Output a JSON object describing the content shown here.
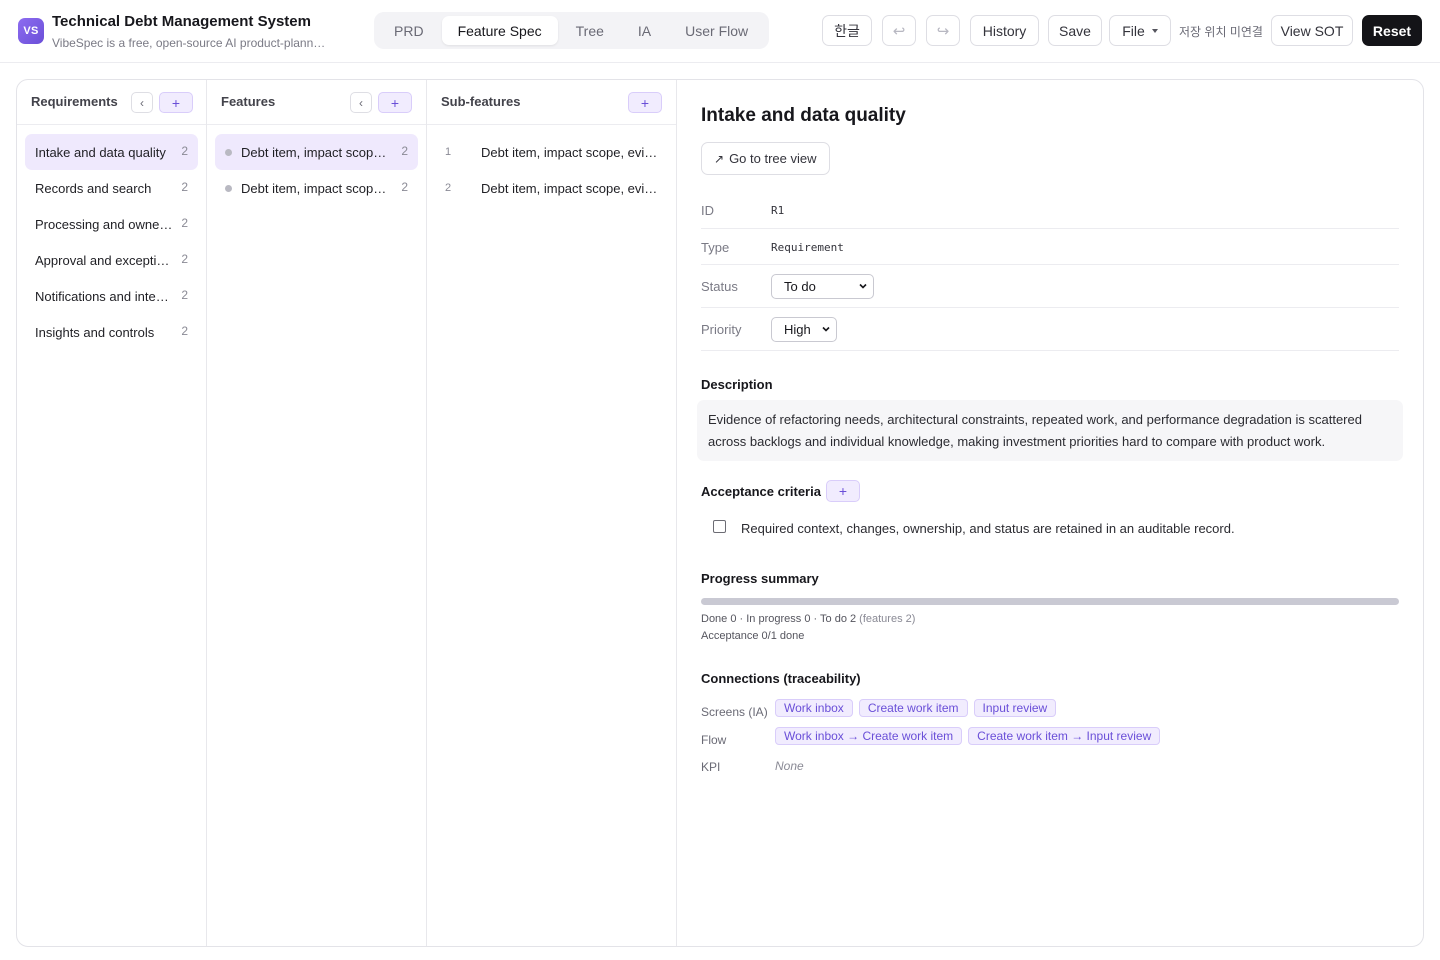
{
  "header": {
    "logo_text": "VS",
    "title": "Technical Debt Management System",
    "subtitle": "VibeSpec is a free, open-source AI product-planning tool",
    "tabs": [
      {
        "label": "PRD",
        "active": false
      },
      {
        "label": "Feature Spec",
        "active": true
      },
      {
        "label": "Tree",
        "active": false
      },
      {
        "label": "IA",
        "active": false
      },
      {
        "label": "User Flow",
        "active": false
      }
    ],
    "lang_label": "한글",
    "undo_icon": "↩",
    "redo_icon": "↪",
    "history_label": "History",
    "save_label": "Save",
    "file_label": "File",
    "save_location": "저장 위치 미연결",
    "view_sot_label": "View SOT",
    "reset_label": "Reset"
  },
  "columns": {
    "requirements": {
      "title": "Requirements",
      "back_icon": "‹",
      "add_icon": "+",
      "items": [
        {
          "label": "Intake and data quality",
          "count": "2"
        },
        {
          "label": "Records and search",
          "count": "2"
        },
        {
          "label": "Processing and ownership",
          "count": "2"
        },
        {
          "label": "Approval and exceptions",
          "count": "2"
        },
        {
          "label": "Notifications and integrations",
          "count": "2"
        },
        {
          "label": "Insights and controls",
          "count": "2"
        }
      ]
    },
    "features": {
      "title": "Features",
      "back_icon": "‹",
      "add_icon": "+",
      "items": [
        {
          "label": "Debt item, impact scope, evidence",
          "count": "2"
        },
        {
          "label": "Debt item, impact scope, evidence",
          "count": "2"
        }
      ]
    },
    "subfeatures": {
      "title": "Sub-features",
      "add_icon": "+",
      "items": [
        {
          "num": "1",
          "label": "Debt item, impact scope, evidence intake"
        },
        {
          "num": "2",
          "label": "Debt item, impact scope, evidence review"
        }
      ]
    }
  },
  "detail": {
    "title": "Intake and data quality",
    "tree_button_icon": "↗",
    "tree_button_label": "Go to tree view",
    "id_label": "ID",
    "id_value": "R1",
    "type_label": "Type",
    "type_value": "Requirement",
    "status_label": "Status",
    "status_value": "To do",
    "priority_label": "Priority",
    "priority_value": "High",
    "description_title": "Description",
    "description": "Evidence of refactoring needs, architectural constraints, repeated work, and performance degradation is scattered across backlogs and individual knowledge, making investment priorities hard to compare with product work.",
    "acceptance_title": "Acceptance criteria",
    "acceptance_add_icon": "+",
    "acceptance_items": [
      {
        "text": "Required context, changes, ownership, and status are retained in an auditable record.",
        "checked": false
      }
    ],
    "progress_title": "Progress summary",
    "progress_fraction": 0,
    "progress_line": "Done 0 · In progress 0 · To do 2",
    "progress_features": "(features 2)",
    "acceptance_line": "Acceptance 0/1 done",
    "connections_title": "Connections (traceability)",
    "screens_label": "Screens (IA)",
    "screens": [
      "Work inbox",
      "Create work item",
      "Input review"
    ],
    "flow_label": "Flow",
    "flows": [
      "Work inbox → Create work item",
      "Create work item → Input review"
    ],
    "kpi_label": "KPI",
    "kpi_value": "None"
  }
}
